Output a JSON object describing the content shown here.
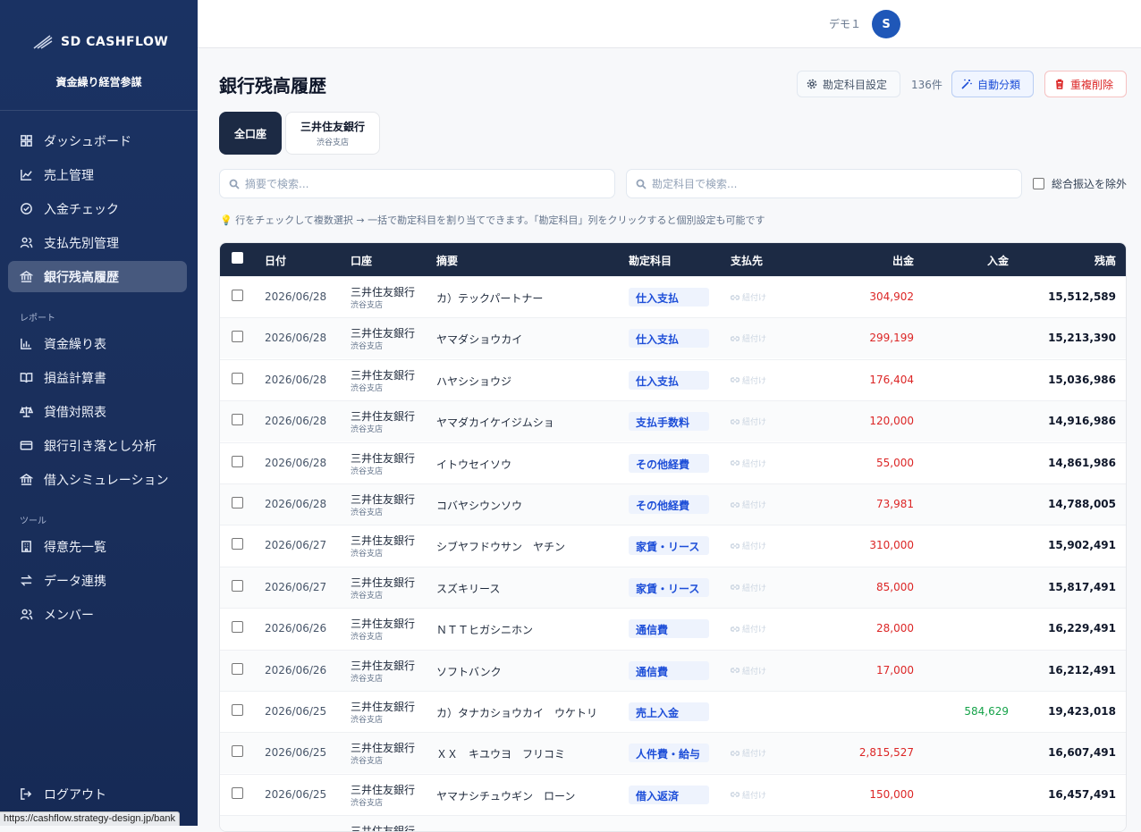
{
  "brand": {
    "name": "SD CASHFLOW",
    "tagline": "資金繰り経営参謀"
  },
  "nav": {
    "main": [
      {
        "label": "ダッシュボード",
        "icon": "grid-icon"
      },
      {
        "label": "売上管理",
        "icon": "line-chart-icon"
      },
      {
        "label": "入金チェック",
        "icon": "check-circle-icon"
      },
      {
        "label": "支払先別管理",
        "icon": "users-icon"
      },
      {
        "label": "銀行残高履歴",
        "icon": "bank-icon",
        "active": true
      }
    ],
    "report_heading": "レポート",
    "report": [
      {
        "label": "資金繰り表",
        "icon": "bar-chart-icon"
      },
      {
        "label": "損益計算書",
        "icon": "book-icon"
      },
      {
        "label": "貸借対照表",
        "icon": "scale-icon"
      },
      {
        "label": "銀行引き落とし分析",
        "icon": "card-icon"
      },
      {
        "label": "借入シミュレーション",
        "icon": "bank-icon"
      }
    ],
    "tools_heading": "ツール",
    "tools": [
      {
        "label": "得意先一覧",
        "icon": "building-icon"
      },
      {
        "label": "データ連携",
        "icon": "swap-icon"
      },
      {
        "label": "メンバー",
        "icon": "users-icon"
      }
    ],
    "logout": "ログアウト"
  },
  "status_url": "https://cashflow.strategy-design.jp/bank",
  "user": {
    "name": "デモ１",
    "initial": "S"
  },
  "page": {
    "title": "銀行残高履歴",
    "settings_label": "勘定科目設定",
    "count": "136件",
    "auto_label": "自動分類",
    "dedupe_label": "重複削除"
  },
  "tabs": {
    "all": "全口座",
    "bank_name": "三井住友銀行",
    "bank_branch": "渋谷支店"
  },
  "search": {
    "desc_placeholder": "摘要で検索...",
    "acct_placeholder": "勘定科目で検索...",
    "exclude_label": "総合振込を除外"
  },
  "hint": "💡 行をチェックして複数選択 → 一括で勘定科目を割り当てできます。「勘定科目」列をクリックすると個別設定も可能です",
  "columns": [
    "日付",
    "口座",
    "摘要",
    "勘定科目",
    "支払先",
    "出金",
    "入金",
    "残高"
  ],
  "link_label": "紐付け",
  "colors": {
    "sidebar": "#1a3263",
    "accent": "#1d4ed8",
    "outflow": "#dc2626",
    "inflow": "#16a34a",
    "header": "#1c2a44"
  },
  "rows": [
    {
      "date": "2026/06/28",
      "bank": "三井住友銀行",
      "branch": "渋谷支店",
      "desc": "カ）テックパートナー",
      "acct": "仕入支払",
      "link": "紐付け",
      "out": "304,902",
      "in": "",
      "bal": "15,512,589"
    },
    {
      "date": "2026/06/28",
      "bank": "三井住友銀行",
      "branch": "渋谷支店",
      "desc": "ヤマダショウカイ",
      "acct": "仕入支払",
      "link": "紐付け",
      "out": "299,199",
      "in": "",
      "bal": "15,213,390"
    },
    {
      "date": "2026/06/28",
      "bank": "三井住友銀行",
      "branch": "渋谷支店",
      "desc": "ハヤシショウジ",
      "acct": "仕入支払",
      "link": "紐付け",
      "out": "176,404",
      "in": "",
      "bal": "15,036,986"
    },
    {
      "date": "2026/06/28",
      "bank": "三井住友銀行",
      "branch": "渋谷支店",
      "desc": "ヤマダカイケイジムショ",
      "acct": "支払手数料",
      "link": "紐付け",
      "out": "120,000",
      "in": "",
      "bal": "14,916,986"
    },
    {
      "date": "2026/06/28",
      "bank": "三井住友銀行",
      "branch": "渋谷支店",
      "desc": "イトウセイソウ",
      "acct": "その他経費",
      "link": "紐付け",
      "out": "55,000",
      "in": "",
      "bal": "14,861,986"
    },
    {
      "date": "2026/06/28",
      "bank": "三井住友銀行",
      "branch": "渋谷支店",
      "desc": "コバヤシウンソウ",
      "acct": "その他経費",
      "link": "紐付け",
      "out": "73,981",
      "in": "",
      "bal": "14,788,005"
    },
    {
      "date": "2026/06/27",
      "bank": "三井住友銀行",
      "branch": "渋谷支店",
      "desc": "シブヤフドウサン　ヤチン",
      "acct": "家賃・リース",
      "link": "紐付け",
      "out": "310,000",
      "in": "",
      "bal": "15,902,491"
    },
    {
      "date": "2026/06/27",
      "bank": "三井住友銀行",
      "branch": "渋谷支店",
      "desc": "スズキリース",
      "acct": "家賃・リース",
      "link": "紐付け",
      "out": "85,000",
      "in": "",
      "bal": "15,817,491"
    },
    {
      "date": "2026/06/26",
      "bank": "三井住友銀行",
      "branch": "渋谷支店",
      "desc": "ＮＴＴヒガシニホン",
      "acct": "通信費",
      "link": "紐付け",
      "out": "28,000",
      "in": "",
      "bal": "16,229,491"
    },
    {
      "date": "2026/06/26",
      "bank": "三井住友銀行",
      "branch": "渋谷支店",
      "desc": "ソフトバンク",
      "acct": "通信費",
      "link": "紐付け",
      "out": "17,000",
      "in": "",
      "bal": "16,212,491"
    },
    {
      "date": "2026/06/25",
      "bank": "三井住友銀行",
      "branch": "渋谷支店",
      "desc": "カ）タナカショウカイ　ウケトリ",
      "acct": "売上入金",
      "link": "",
      "out": "",
      "in": "584,629",
      "bal": "19,423,018"
    },
    {
      "date": "2026/06/25",
      "bank": "三井住友銀行",
      "branch": "渋谷支店",
      "desc": "ＸＸ　キユウヨ　フリコミ",
      "acct": "人件費・給与",
      "link": "紐付け",
      "out": "2,815,527",
      "in": "",
      "bal": "16,607,491"
    },
    {
      "date": "2026/06/25",
      "bank": "三井住友銀行",
      "branch": "渋谷支店",
      "desc": "ヤマナシチュウギン　ローン",
      "acct": "借入返済",
      "link": "紐付け",
      "out": "150,000",
      "in": "",
      "bal": "16,457,491"
    },
    {
      "date": "",
      "bank": "三井住友銀行",
      "branch": "",
      "desc": "",
      "acct": "",
      "link": "",
      "out": "",
      "in": "",
      "bal": ""
    }
  ]
}
